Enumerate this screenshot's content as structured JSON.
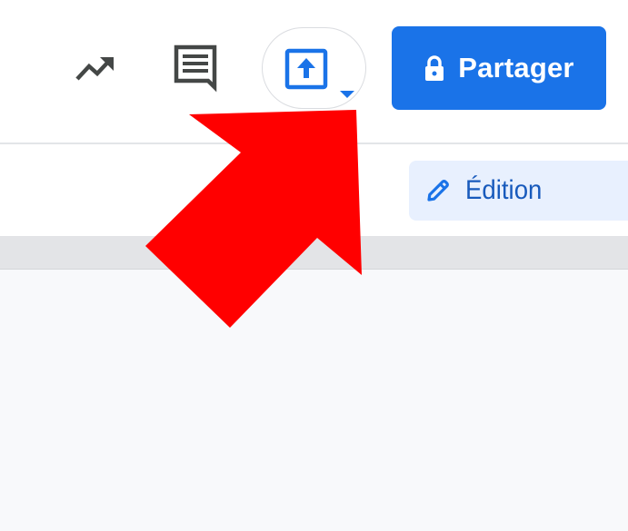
{
  "toolbar": {
    "activity_icon": "trending-up-icon",
    "comments_icon": "comment-lines-icon",
    "present": {
      "icon": "present-to-screen-icon",
      "dropdown_icon": "caret-down-icon"
    },
    "share": {
      "icon": "lock-icon",
      "label": "Partager"
    }
  },
  "subtoolbar": {
    "mode": {
      "icon": "pencil-icon",
      "label": "Édition"
    }
  },
  "annotation": {
    "type": "arrow",
    "color": "#ff0000",
    "points_to": "present-button"
  },
  "colors": {
    "accent": "#1a73e8",
    "mode_bg": "#e8f0fe",
    "mode_text": "#185abc",
    "icon_gray": "#444746",
    "annotation_red": "#ff0000"
  }
}
